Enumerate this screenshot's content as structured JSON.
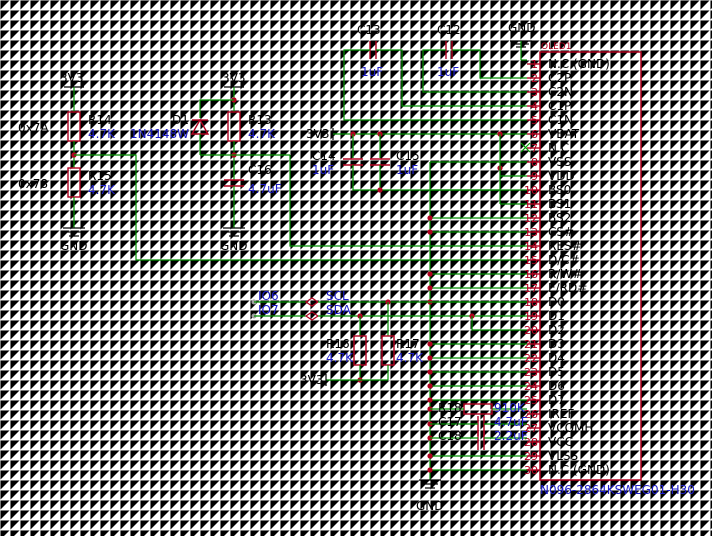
{
  "oled": {
    "ref": "OLED1",
    "part": "N096-2864KSWEG01-H30",
    "pins": [
      {
        "num": "1",
        "name": "N.C.(GND)"
      },
      {
        "num": "2",
        "name": "C2P"
      },
      {
        "num": "3",
        "name": "C2N"
      },
      {
        "num": "4",
        "name": "C1P"
      },
      {
        "num": "5",
        "name": "C1N"
      },
      {
        "num": "6",
        "name": "VBAT"
      },
      {
        "num": "7",
        "name": "N.C."
      },
      {
        "num": "8",
        "name": "VSS"
      },
      {
        "num": "9",
        "name": "VDD"
      },
      {
        "num": "10",
        "name": "BS0"
      },
      {
        "num": "11",
        "name": "BS1"
      },
      {
        "num": "12",
        "name": "BS2"
      },
      {
        "num": "13",
        "name": "CS#"
      },
      {
        "num": "14",
        "name": "RES#"
      },
      {
        "num": "15",
        "name": "D/C#"
      },
      {
        "num": "16",
        "name": "R/W#"
      },
      {
        "num": "17",
        "name": "E/RD#"
      },
      {
        "num": "18",
        "name": "D0"
      },
      {
        "num": "19",
        "name": "D1"
      },
      {
        "num": "20",
        "name": "D2"
      },
      {
        "num": "21",
        "name": "D3"
      },
      {
        "num": "22",
        "name": "D4"
      },
      {
        "num": "23",
        "name": "D5"
      },
      {
        "num": "24",
        "name": "D6"
      },
      {
        "num": "25",
        "name": "D7"
      },
      {
        "num": "26",
        "name": "IREF"
      },
      {
        "num": "27",
        "name": "VCOMH"
      },
      {
        "num": "28",
        "name": "VCC"
      },
      {
        "num": "29",
        "name": "VLSS"
      },
      {
        "num": "30",
        "name": "N.C.(GND)"
      }
    ]
  },
  "components": {
    "c13": {
      "ref": "C13",
      "value": "1uF"
    },
    "c12": {
      "ref": "C12",
      "value": "1uF"
    },
    "c14": {
      "ref": "C14",
      "value": "1uF"
    },
    "c15": {
      "ref": "C15",
      "value": "1uF"
    },
    "c16": {
      "ref": "C16",
      "value": "4.7uF"
    },
    "c17": {
      "ref": "C17",
      "value": "4.7uF"
    },
    "c18": {
      "ref": "C18",
      "value": "2.2uF"
    },
    "r13": {
      "ref": "R13",
      "value": "4.7K"
    },
    "r14": {
      "ref": "R14",
      "value": "4.7K"
    },
    "r15": {
      "ref": "R15",
      "value": "4.7K"
    },
    "r16": {
      "ref": "R16",
      "value": "4.7K"
    },
    "r17": {
      "ref": "R17",
      "value": "4.7K"
    },
    "r18": {
      "ref": "R18",
      "value": "910K"
    },
    "d1": {
      "ref": "D1",
      "value": "1N4148W"
    }
  },
  "power": {
    "v33": "3V3",
    "gnd": "GND"
  },
  "nets": {
    "io6": "IO6",
    "io7": "IO7",
    "scl": "SCL",
    "sda": "SDA"
  },
  "notes": {
    "addr_7a": "0x7A",
    "addr_78": "0x78"
  }
}
